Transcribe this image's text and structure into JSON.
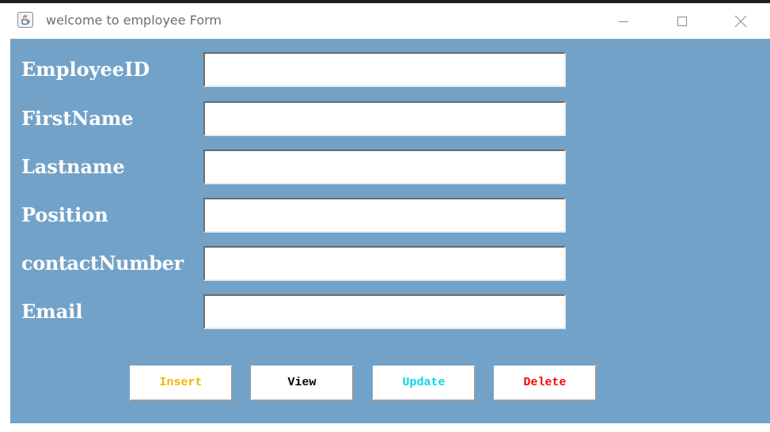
{
  "window": {
    "title": "welcome to employee Form"
  },
  "icons": {
    "app": "java-cup-icon",
    "minimize": "minimize-icon",
    "maximize": "maximize-icon",
    "close": "close-icon"
  },
  "form": {
    "fields": [
      {
        "label": "EmployeeID",
        "value": ""
      },
      {
        "label": "FirstName",
        "value": ""
      },
      {
        "label": "Lastname",
        "value": ""
      },
      {
        "label": "Position",
        "value": ""
      },
      {
        "label": "contactNumber",
        "value": ""
      },
      {
        "label": "Email",
        "value": ""
      }
    ]
  },
  "buttons": {
    "insert": {
      "label": "Insert",
      "color": "#f5b400"
    },
    "view": {
      "label": "View",
      "color": "#000000"
    },
    "update": {
      "label": "Update",
      "color": "#00d8ea"
    },
    "delete": {
      "label": "Delete",
      "color": "#ff0000"
    }
  },
  "colors": {
    "panel_background": "#73a2c8",
    "label_text": "#ffffff",
    "title_text": "#6e6e6e"
  }
}
